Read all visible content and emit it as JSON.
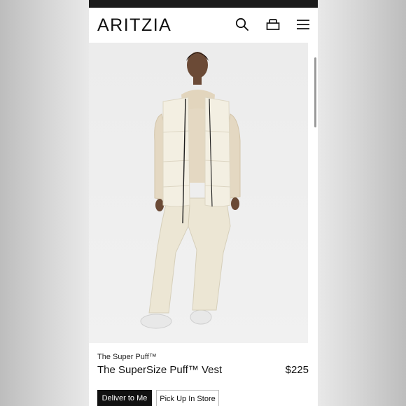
{
  "header": {
    "logo": "ARITZIA",
    "icons": [
      "search-icon",
      "bag-icon",
      "menu-icon"
    ]
  },
  "product": {
    "brand": "The Super Puff™",
    "name": "The SuperSize Puff™ Vest",
    "price": "$225"
  },
  "delivery": {
    "deliver_label": "Deliver to Me",
    "pickup_label": "Pick Up In Store",
    "selected": "Deliver to Me"
  },
  "colors": {
    "text": "#111111",
    "button_selected_bg": "#111111",
    "vest": "#f3efe2",
    "sweatshirt": "#e4d8c2",
    "pants": "#ece6d4"
  }
}
